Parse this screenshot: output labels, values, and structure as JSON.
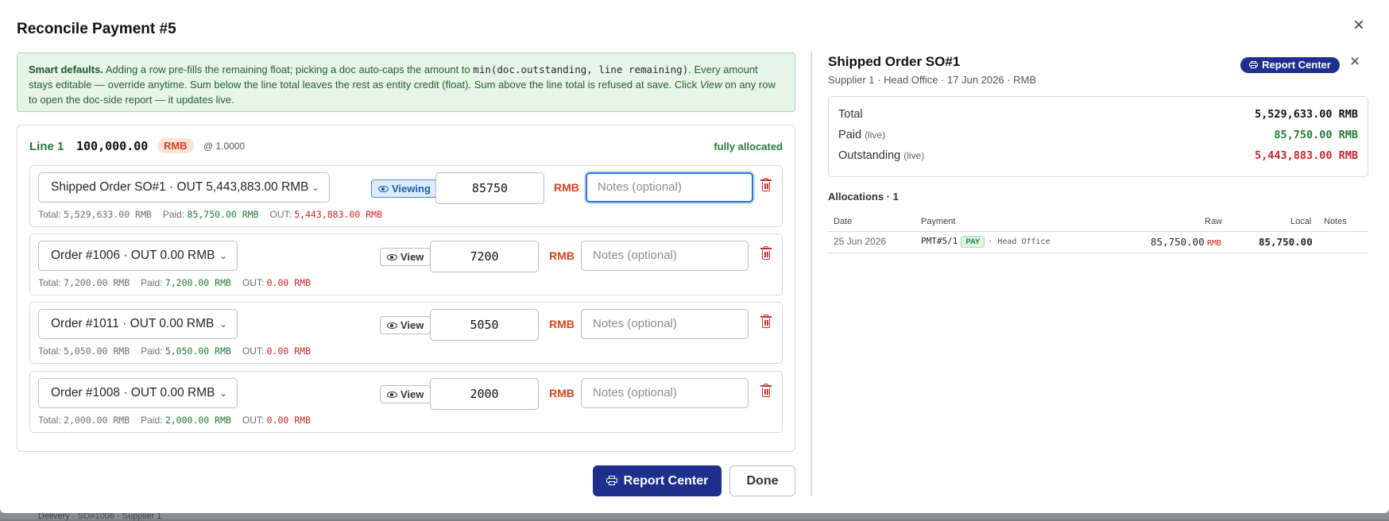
{
  "modal": {
    "title": "Reconcile Payment #5",
    "close_icon": "×"
  },
  "info": {
    "heading": "Smart defaults.",
    "text1": " Adding a row pre-fills the remaining float; picking a doc auto-caps the amount to ",
    "code": "min(doc.outstanding, line remaining)",
    "text2": ". Every amount stays editable — override anytime. Sum below the line total leaves the rest as entity credit (float). Sum above the line total is refused at save. Click ",
    "view_word": "View",
    "text3": " on any row to open the doc-side report — it updates live."
  },
  "line": {
    "label": "Line 1",
    "amount": "100,000.00",
    "currency": "RMB",
    "rate": "@ 1.0000",
    "status": "fully allocated"
  },
  "rows": [
    {
      "doc": "Shipped Order SO#1 · OUT 5,443,883.00 RMB",
      "view_label": "Viewing",
      "amount": "85750",
      "currency": "RMB",
      "notes_placeholder": "Notes (optional)",
      "total_label": "Total:",
      "total": "5,529,633.00 RMB",
      "paid_label": "Paid:",
      "paid": "85,750.00 RMB",
      "out_label": "OUT:",
      "out": "5,443,883.00 RMB"
    },
    {
      "doc": "Order #1006 · OUT 0.00 RMB",
      "view_label": "View",
      "amount": "7200",
      "currency": "RMB",
      "notes_placeholder": "Notes (optional)",
      "total_label": "Total:",
      "total": "7,200.00 RMB",
      "paid_label": "Paid:",
      "paid": "7,200.00 RMB",
      "out_label": "OUT:",
      "out": "0.00 RMB"
    },
    {
      "doc": "Order #1011 · OUT 0.00 RMB",
      "view_label": "View",
      "amount": "5050",
      "currency": "RMB",
      "notes_placeholder": "Notes (optional)",
      "total_label": "Total:",
      "total": "5,050.00 RMB",
      "paid_label": "Paid:",
      "paid": "5,050.00 RMB",
      "out_label": "OUT:",
      "out": "0.00 RMB"
    },
    {
      "doc": "Order #1008 · OUT 0.00 RMB",
      "view_label": "View",
      "amount": "2000",
      "currency": "RMB",
      "notes_placeholder": "Notes (optional)",
      "total_label": "Total:",
      "total": "2,000.00 RMB",
      "paid_label": "Paid:",
      "paid": "2,000.00 RMB",
      "out_label": "OUT:",
      "out": "0.00 RMB"
    }
  ],
  "footer": {
    "report_label": "Report Center",
    "done_label": "Done"
  },
  "side": {
    "title": "Shipped Order SO#1",
    "subtitle": "Supplier 1 · Head Office · 17 Jun 2026 · RMB",
    "report_label": "Report Center",
    "close_icon": "×",
    "totals": {
      "total_label": "Total",
      "total": "5,529,633.00 RMB",
      "paid_label": "Paid",
      "paid_live": "(live)",
      "paid": "85,750.00 RMB",
      "outstanding_label": "Outstanding",
      "outstanding_live": "(live)",
      "outstanding": "5,443,883.00 RMB"
    },
    "alloc_title": "Allocations · 1",
    "alloc_columns": [
      "Date",
      "Payment",
      "Raw",
      "Local",
      "Notes"
    ],
    "alloc_rows": [
      {
        "date": "25 Jun 2026",
        "payment": "PMT#5/1",
        "badge": "PAY",
        "office": "· Head Office",
        "raw": "85,750.00",
        "raw_currency": "RMB",
        "local": "85,750.00",
        "notes": ""
      }
    ]
  },
  "backdrop": {
    "peek_text": "Delivery · SO#1006 · Supplier 1"
  },
  "colors": {
    "accent_navy": "#1e2f8c",
    "success_green": "#247a3a",
    "danger_red": "#c62828",
    "currency_orange": "#d2461c"
  }
}
